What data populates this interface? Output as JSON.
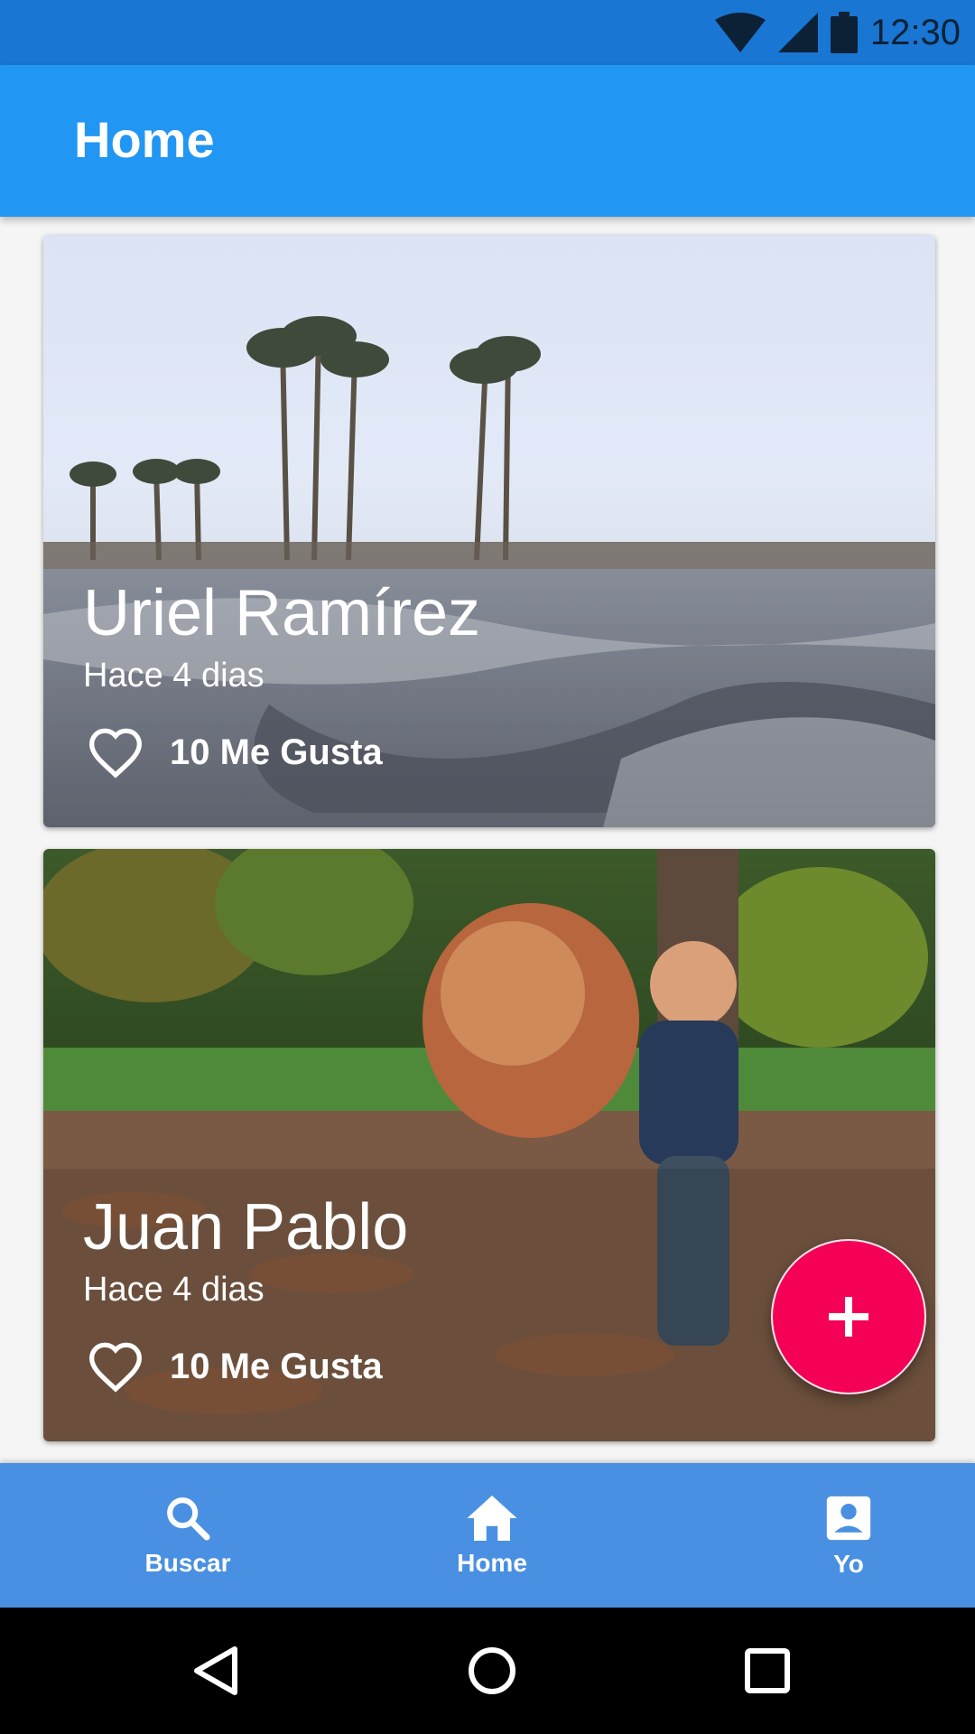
{
  "status_bar": {
    "time": "12:30"
  },
  "app_bar": {
    "title": "Home"
  },
  "posts": [
    {
      "name": "Uriel Ramírez",
      "time": "Hace 4 dias",
      "likes": "10 Me Gusta"
    },
    {
      "name": "Juan Pablo",
      "time": "Hace 4 dias",
      "likes": "10 Me Gusta"
    }
  ],
  "fab": {
    "icon": "plus-icon"
  },
  "bottom_nav": {
    "items": [
      {
        "label": "Buscar",
        "icon": "search-icon"
      },
      {
        "label": "Home",
        "icon": "home-icon"
      },
      {
        "label": "Yo",
        "icon": "account-icon"
      }
    ]
  },
  "colors": {
    "status_bar": "#1976d2",
    "app_bar": "#2196f3",
    "bottom_nav": "#4a90e2",
    "fab": "#f50057"
  }
}
